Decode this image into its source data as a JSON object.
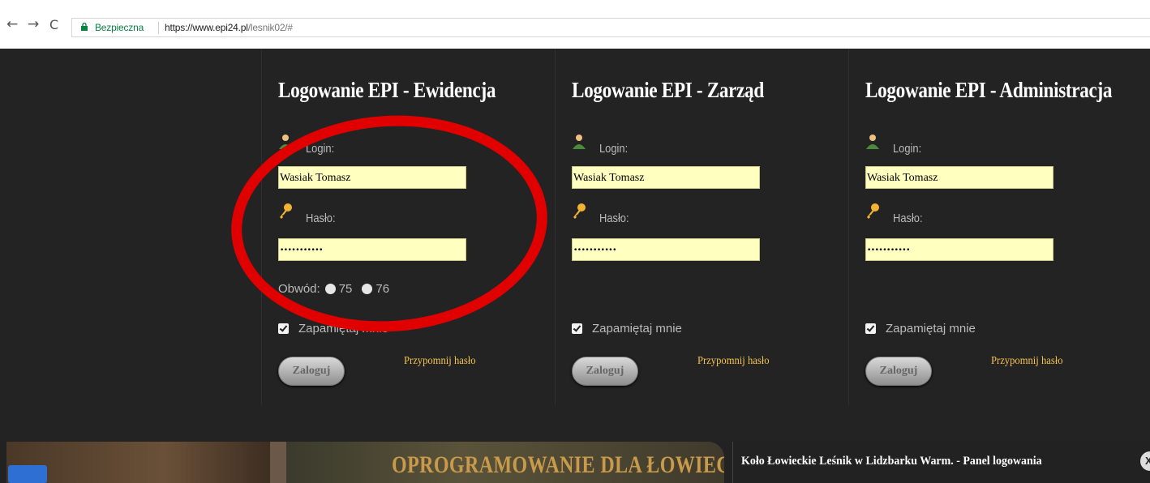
{
  "browser": {
    "back": "←",
    "forward": "→",
    "reload": "C",
    "secure_label": "Bezpieczna",
    "url_prefix": "https://www.epi24.pl",
    "url_path": "/lesnik02/#"
  },
  "panels": [
    {
      "title": "Logowanie EPI - Ewidencja",
      "login_label": "Login:",
      "login_value": "Wasiak Tomasz",
      "password_label": "Hasło:",
      "password_value": "•••••••••••",
      "district_label": "Obwód:",
      "district_options": [
        "75",
        "76"
      ],
      "remember_label": "Zapamiętaj mnie",
      "login_button": "Zaloguj",
      "remind_link": "Przypomnij hasło"
    },
    {
      "title": "Logowanie EPI - Zarząd",
      "login_label": "Login:",
      "login_value": "Wasiak Tomasz",
      "password_label": "Hasło:",
      "password_value": "•••••••••••",
      "remember_label": "Zapamiętaj mnie",
      "login_button": "Zaloguj",
      "remind_link": "Przypomnij hasło"
    },
    {
      "title": "Logowanie EPI - Administracja",
      "login_label": "Login:",
      "login_value": "Wasiak Tomasz",
      "password_label": "Hasło:",
      "password_value": "•••••••••••",
      "remember_label": "Zapamiętaj mnie",
      "login_button": "Zaloguj",
      "remind_link": "Przypomnij hasło"
    }
  ],
  "footer": {
    "banner_text": "OPROGRAMOWANIE DLA ŁOWIECTW",
    "site_title": "Koło Łowieckie Leśnik w Lidzbarku Warm. - Panel logowania",
    "close": "X"
  },
  "colors": {
    "panel_bg": "#232323",
    "input_bg": "#ffffc0",
    "link": "#f5c24a",
    "annotation": "#e10000",
    "secure": "#0b8043"
  },
  "icons": [
    "back-arrow-icon",
    "forward-arrow-icon",
    "reload-icon",
    "lock-icon",
    "user-icon",
    "key-icon",
    "checkbox-icon",
    "radio-icon",
    "close-icon"
  ]
}
